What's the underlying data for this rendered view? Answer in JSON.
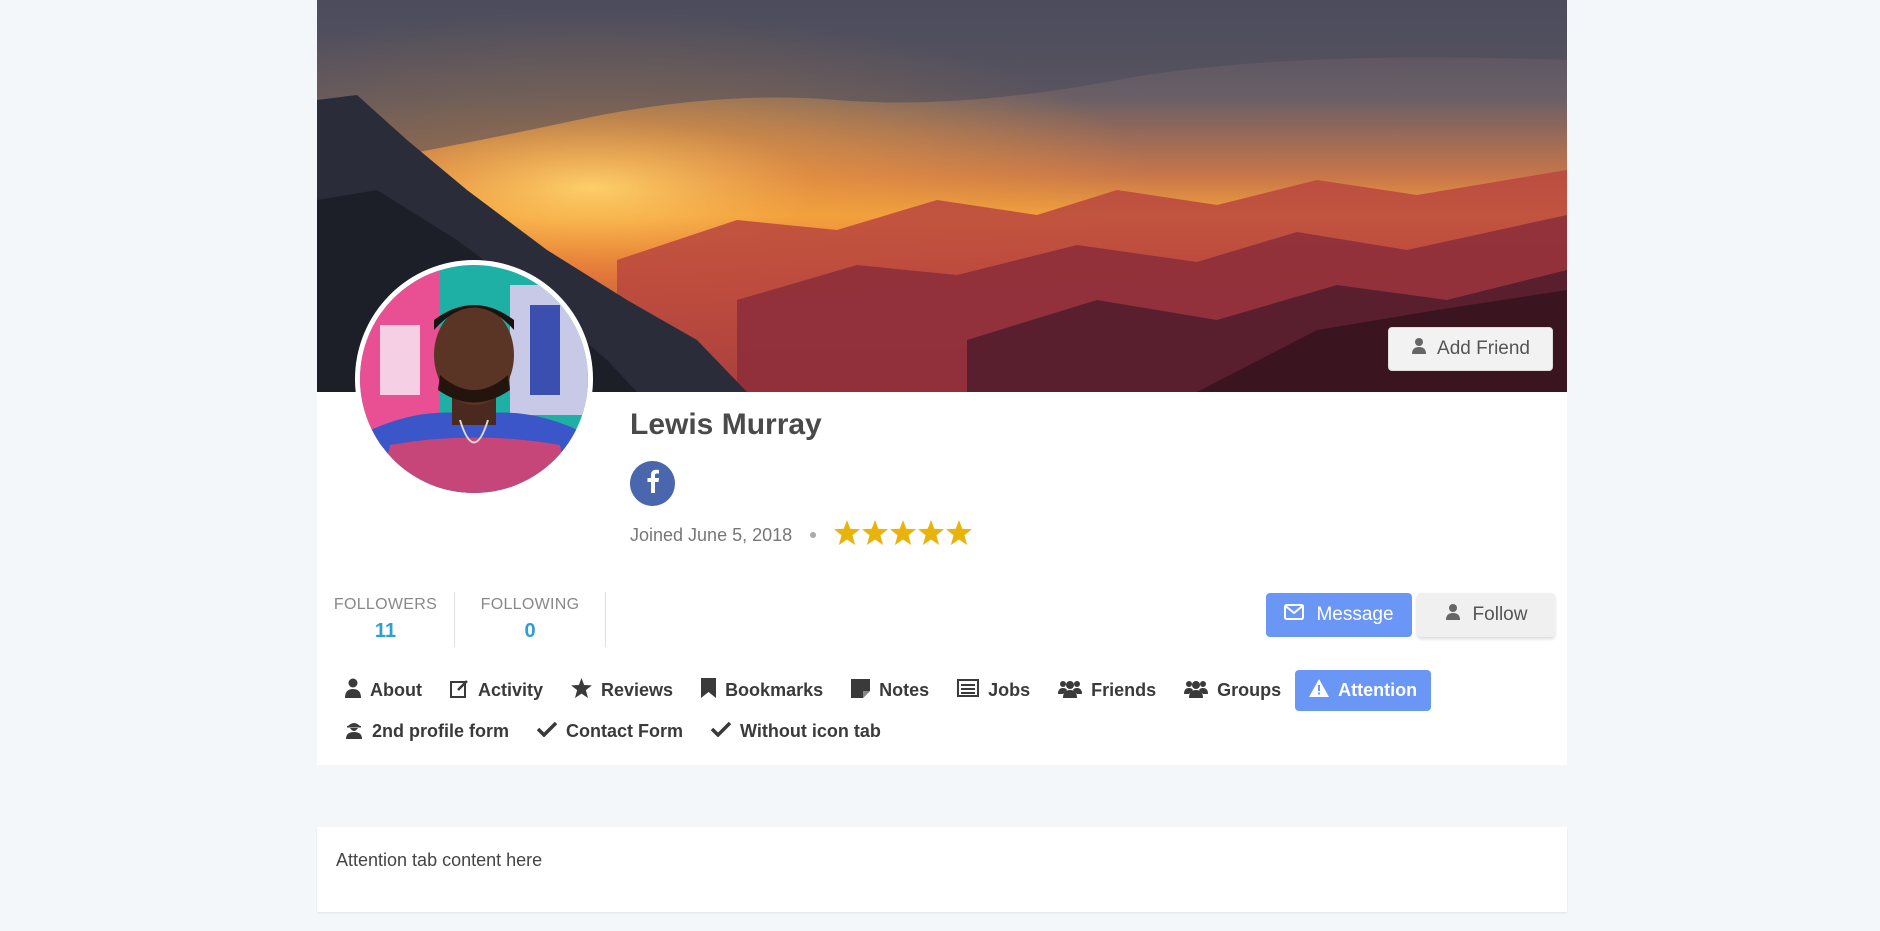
{
  "profile": {
    "name": "Lewis Murray",
    "joined": "Joined June 5, 2018",
    "rating": 5,
    "add_friend_label": "Add Friend",
    "social": [
      "facebook-icon"
    ]
  },
  "stats": [
    {
      "label": "FOLLOWERS",
      "value": "11"
    },
    {
      "label": "FOLLOWING",
      "value": "0"
    }
  ],
  "actions": {
    "message_label": "Message",
    "follow_label": "Follow"
  },
  "tabs": {
    "row1": [
      {
        "label": "About",
        "icon": "user-icon"
      },
      {
        "label": "Activity",
        "icon": "edit-icon"
      },
      {
        "label": "Reviews",
        "icon": "star-icon"
      },
      {
        "label": "Bookmarks",
        "icon": "bookmark-icon"
      },
      {
        "label": "Notes",
        "icon": "note-icon"
      },
      {
        "label": "Jobs",
        "icon": "list-icon"
      },
      {
        "label": "Friends",
        "icon": "users-icon"
      },
      {
        "label": "Groups",
        "icon": "users-icon"
      },
      {
        "label": "Attention",
        "icon": "warning-icon",
        "active": true
      }
    ],
    "row2": [
      {
        "label": "2nd profile form",
        "icon": "user-secret-icon"
      },
      {
        "label": "Contact Form",
        "icon": "check-icon"
      },
      {
        "label": "Without icon tab",
        "icon": "check-icon"
      }
    ]
  },
  "content": {
    "text": "Attention tab content here"
  },
  "colors": {
    "accent": "#6a97f5",
    "stat_value": "#2f9fd0",
    "star": "#e8b30b",
    "facebook": "#4a67ad"
  }
}
